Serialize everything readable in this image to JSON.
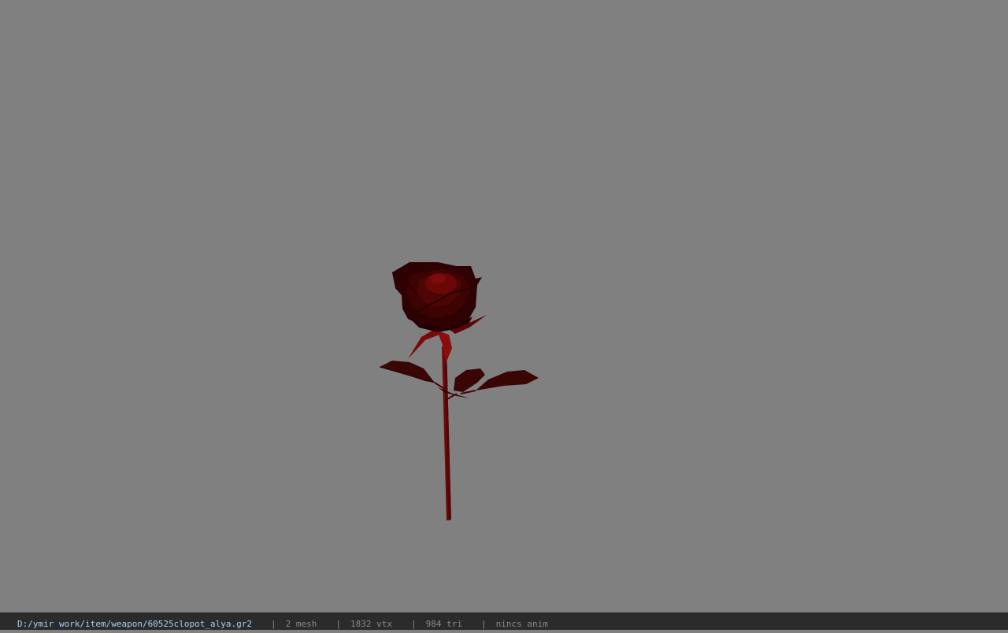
{
  "viewport": {
    "background_color": "#808080",
    "model": {
      "name": "rose-model",
      "colors": {
        "petal_dark": "#2e0202",
        "petal_mid": "#4a0404",
        "petal_light": "#7a0a0a",
        "stem": "#6e0a0a",
        "leaf": "#3a0505"
      }
    }
  },
  "statusbar": {
    "path": "D:/ymir work/item/weapon/60525clopot_alya.gr2",
    "separator": "|",
    "mesh": "2 mesh",
    "vertices": "1832 vtx",
    "triangles": "984 tri",
    "animation": "nincs anim",
    "path_color": "#9fd2f0",
    "text_color": "#8a8a8a"
  }
}
